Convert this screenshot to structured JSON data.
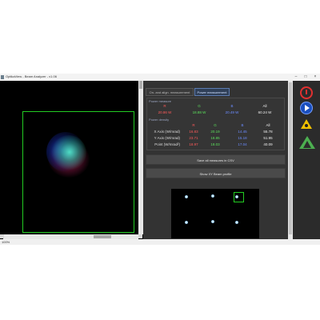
{
  "window": {
    "title": "OptikaView - Beam Analyzer - v1.06",
    "minimize_glyph": "–",
    "maximize_glyph": "□",
    "close_glyph": "×"
  },
  "tabs": [
    {
      "label": "On- and align. measurement",
      "active": false
    },
    {
      "label": "Power measurement",
      "active": true
    }
  ],
  "power_measure": {
    "section_label": "Power measure",
    "headers": [
      "R",
      "G",
      "B",
      "All"
    ],
    "values": [
      "20.86 W",
      "18.88 W",
      "20.49 W",
      "60.24 W"
    ]
  },
  "power_density": {
    "section_label": "Power density",
    "headers": [
      "R",
      "G",
      "B",
      "All"
    ],
    "rows": [
      {
        "label": "X Axis (W/mrad)",
        "values": [
          "16.83",
          "20.19",
          "14.45",
          "55.78"
        ]
      },
      {
        "label": "Y Axis (W/mrad)",
        "values": [
          "23.71",
          "18.85",
          "15.18",
          "51.95"
        ]
      },
      {
        "label": "Point (W/mrad²)",
        "values": [
          "18.97",
          "18.03",
          "17.04",
          "40.09"
        ]
      }
    ]
  },
  "buttons": {
    "save_csv": "Save all measures in CSV",
    "show_xy": "Show XY Beam profile"
  },
  "status": {
    "zoom": "100%"
  },
  "colors": {
    "red": "#ff5a5a",
    "green": "#5be05b",
    "blue": "#6b8cff",
    "roi": "#22cc22"
  },
  "side_toolbar": {
    "icons": [
      "power-icon",
      "play-icon",
      "laser-warning-icon",
      "app-logo-icon"
    ]
  }
}
